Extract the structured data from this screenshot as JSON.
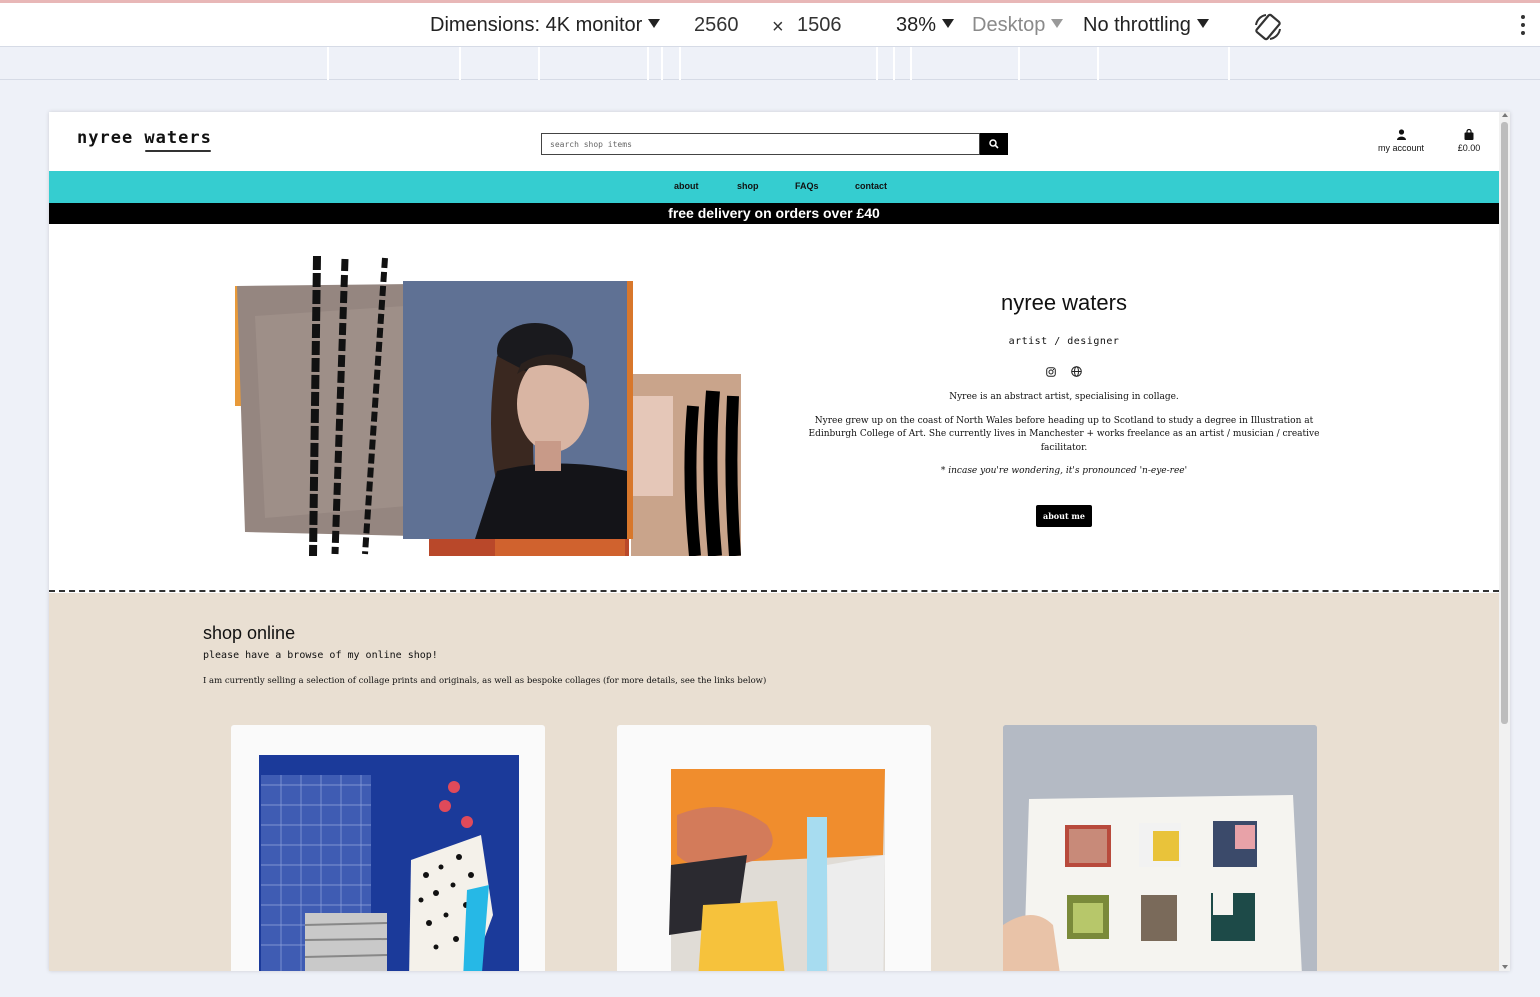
{
  "devtools": {
    "dimensions_label": "Dimensions: 4K monitor",
    "width": "2560",
    "times": "×",
    "height": "1506",
    "zoom": "38%",
    "device_type": "Desktop",
    "throttling": "No throttling"
  },
  "site": {
    "logo_text": "nyree waters",
    "search_placeholder": "search shop items",
    "account_label": "my account",
    "basket_total": "£0.00",
    "nav": [
      "about",
      "shop",
      "FAQs",
      "contact"
    ],
    "delivery_banner": "free delivery on orders over £40"
  },
  "hero": {
    "name": "nyree waters",
    "role": "artist / designer",
    "social_icons": [
      "instagram-icon",
      "globe-icon"
    ],
    "bio_1": "Nyree is an abstract artist, specialising in collage.",
    "bio_2": "Nyree grew up on the coast of North Wales before heading up to Scotland to study a degree in Illustration at Edinburgh College of Art. She currently lives in Manchester + works freelance as an artist / musician / creative facilitator.",
    "note": "* incase you're wondering, it's pronounced 'n-eye-ree'",
    "button_label": "about me"
  },
  "shop": {
    "title": "shop online",
    "subtitle": "please have a browse of my online shop!",
    "description": "I am currently selling a selection of collage prints and originals, as well as bespoke collages (for more details, see the links below)"
  },
  "colors": {
    "nav_bg": "#35cdd0",
    "banner_bg": "#000000",
    "shop_bg": "#e9dfd2"
  }
}
